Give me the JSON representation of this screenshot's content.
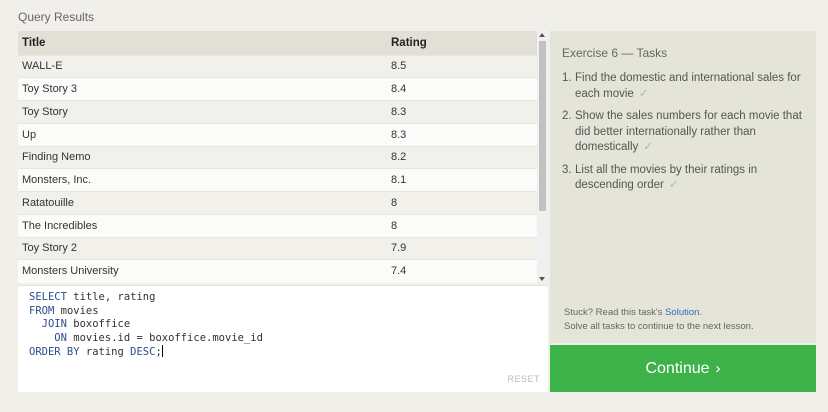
{
  "results": {
    "title": "Query Results",
    "columns": [
      "Title",
      "Rating"
    ],
    "rows": [
      [
        "WALL-E",
        "8.5"
      ],
      [
        "Toy Story 3",
        "8.4"
      ],
      [
        "Toy Story",
        "8.3"
      ],
      [
        "Up",
        "8.3"
      ],
      [
        "Finding Nemo",
        "8.2"
      ],
      [
        "Monsters, Inc.",
        "8.1"
      ],
      [
        "Ratatouille",
        "8"
      ],
      [
        "The Incredibles",
        "8"
      ],
      [
        "Toy Story 2",
        "7.9"
      ],
      [
        "Monsters University",
        "7.4"
      ]
    ]
  },
  "editor": {
    "lines": [
      [
        {
          "k": true,
          "t": "SELECT"
        },
        {
          "k": false,
          "t": " title, rating"
        }
      ],
      [
        {
          "k": true,
          "t": "FROM"
        },
        {
          "k": false,
          "t": " movies"
        }
      ],
      [
        {
          "k": false,
          "t": "  "
        },
        {
          "k": true,
          "t": "JOIN"
        },
        {
          "k": false,
          "t": " boxoffice"
        }
      ],
      [
        {
          "k": false,
          "t": "    "
        },
        {
          "k": true,
          "t": "ON"
        },
        {
          "k": false,
          "t": " movies.id = boxoffice.movie_id"
        }
      ],
      [
        {
          "k": true,
          "t": "ORDER BY"
        },
        {
          "k": false,
          "t": " rating "
        },
        {
          "k": true,
          "t": "DESC"
        },
        {
          "k": false,
          "t": ";"
        }
      ]
    ],
    "reset_label": "RESET"
  },
  "tasks": {
    "title": "Exercise 6 — Tasks",
    "items": [
      {
        "num": "1.",
        "text": "Find the domestic and international sales for each movie",
        "check": "✓"
      },
      {
        "num": "2.",
        "text": "Show the sales numbers for each movie that did better internationally rather than domestically",
        "check": "✓"
      },
      {
        "num": "3.",
        "text": "List all the movies by their ratings in descending order",
        "check": "✓"
      }
    ]
  },
  "help": {
    "stuck_prefix": "Stuck? Read this task's ",
    "solution_link": "Solution",
    "stuck_suffix": ".",
    "continue_note": "Solve all tasks to continue to the next lesson."
  },
  "continue_button": {
    "label": "Continue",
    "arrow": "›",
    "color": "#3db249"
  }
}
